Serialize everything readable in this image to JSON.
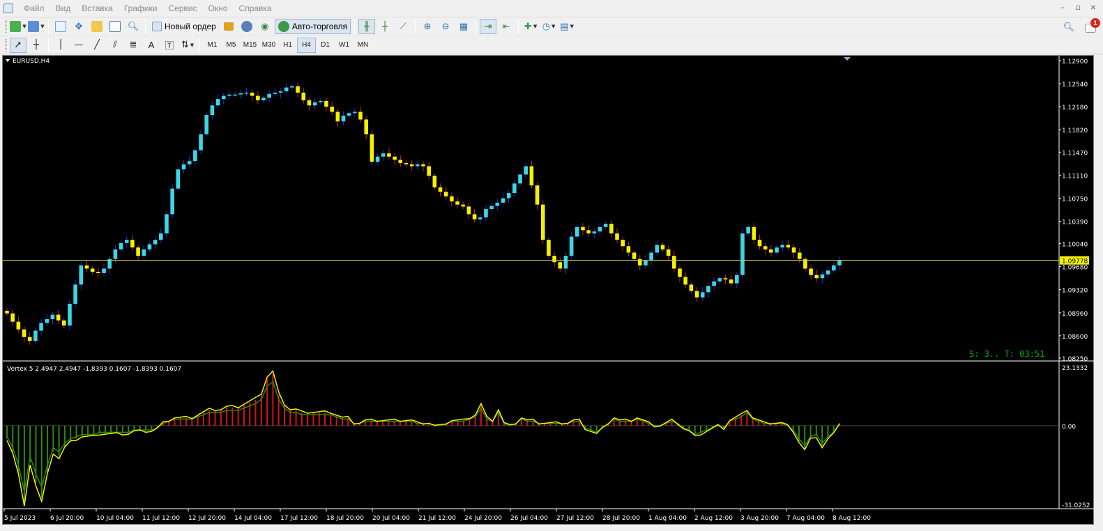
{
  "menu": [
    "Файл",
    "Вид",
    "Вставка",
    "Графики",
    "Сервис",
    "Окно",
    "Справка"
  ],
  "window_controls": [
    "–",
    "▫",
    "×"
  ],
  "toolbar": {
    "new_order_label": "Новый ордер",
    "autotrade_label": "Авто-торговля",
    "notification_count": "1"
  },
  "timeframes": [
    "M1",
    "M5",
    "M15",
    "M30",
    "H1",
    "H4",
    "D1",
    "W1",
    "MN"
  ],
  "active_timeframe": "H4",
  "chart": {
    "symbol_label": "EURUSD,H4",
    "indicator_label": "Vertex 5 2.4947 2.4947 -1.8393 0.1607 -1.8393 0.1607",
    "current_price_label": "1.09778",
    "status_text": "S: 3.. T: 03:51",
    "price_ticks": [
      "1.12900",
      "1.12540",
      "1.12180",
      "1.11820",
      "1.11470",
      "1.11110",
      "1.10750",
      "1.10390",
      "1.10040",
      "1.09680",
      "1.09320",
      "1.08960",
      "1.08600",
      "1.08250"
    ],
    "indicator_ticks": [
      "23.1332",
      "0.00",
      "-31.0252"
    ],
    "time_ticks": [
      "5 Jul 2023",
      "6 Jul 20:00",
      "10 Jul 04:00",
      "11 Jul 12:00",
      "12 Jul 20:00",
      "14 Jul 04:00",
      "17 Jul 12:00",
      "18 Jul 20:00",
      "20 Jul 04:00",
      "21 Jul 12:00",
      "24 Jul 20:00",
      "26 Jul 04:00",
      "27 Jul 12:00",
      "28 Jul 20:00",
      "1 Aug 04:00",
      "2 Aug 12:00",
      "3 Aug 20:00",
      "7 Aug 04:00",
      "8 Aug 12:00"
    ],
    "colors": {
      "background": "#000000",
      "bull": "#3cd6e6",
      "bear": "#f5f000",
      "wick": "#2030d0",
      "wick_bear": "#c03020",
      "price_line": "#c8c850",
      "axis_text": "#ffffff",
      "status_text": "#00b000",
      "osc_red": "#e01010",
      "osc_green": "#2a8a10",
      "osc_yellow": "#f5f000"
    }
  },
  "chart_data": {
    "type": "candlestick",
    "ylim": [
      1.0825,
      1.129
    ],
    "current_price": 1.09778,
    "closes": [
      1.0895,
      1.0882,
      1.087,
      1.0858,
      1.0852,
      1.0868,
      1.088,
      1.0886,
      1.0893,
      1.0884,
      1.0876,
      1.091,
      1.094,
      1.097,
      1.0965,
      1.096,
      1.0958,
      1.0965,
      1.098,
      1.0995,
      1.1005,
      1.101,
      1.0998,
      1.0985,
      1.0995,
      1.1003,
      1.101,
      1.102,
      1.105,
      1.109,
      1.112,
      1.1128,
      1.1133,
      1.115,
      1.1175,
      1.1205,
      1.122,
      1.123,
      1.1235,
      1.1237,
      1.1237,
      1.1239,
      1.124,
      1.1235,
      1.1228,
      1.1232,
      1.1238,
      1.124,
      1.1242,
      1.1248,
      1.125,
      1.124,
      1.1228,
      1.122,
      1.1225,
      1.1227,
      1.1218,
      1.121,
      1.1195,
      1.1204,
      1.1208,
      1.121,
      1.1198,
      1.1175,
      1.1132,
      1.114,
      1.1145,
      1.114,
      1.1135,
      1.113,
      1.1128,
      1.1125,
      1.1128,
      1.1125,
      1.111,
      1.1092,
      1.1085,
      1.1078,
      1.107,
      1.1065,
      1.1062,
      1.105,
      1.1042,
      1.1045,
      1.1058,
      1.1063,
      1.1068,
      1.1075,
      1.1083,
      1.1098,
      1.1112,
      1.1125,
      1.1095,
      1.1065,
      1.101,
      1.0985,
      1.0975,
      1.0965,
      1.0985,
      1.1015,
      1.103,
      1.1025,
      1.102,
      1.1023,
      1.103,
      1.1035,
      1.102,
      1.101,
      1.1,
      1.099,
      1.098,
      1.097,
      1.0978,
      1.099,
      1.1002,
      1.0995,
      1.0985,
      1.0965,
      1.0952,
      1.094,
      1.093,
      1.092,
      1.0928,
      1.0938,
      1.0945,
      1.095,
      1.0948,
      1.0942,
      1.0955,
      1.102,
      1.103,
      1.101,
      1.1,
      1.0995,
      1.099,
      1.0998,
      1.1002,
      1.0998,
      1.099,
      1.098,
      1.0965,
      1.0955,
      1.095,
      1.0956,
      1.0962,
      1.097,
      1.0978
    ],
    "oscillator_ylim": [
      -31.0252,
      23.1332
    ],
    "oscillator": [
      -5,
      -10,
      -18,
      -30,
      -14,
      -22,
      -28,
      -18,
      -10,
      -12,
      -8,
      -6,
      -5,
      -4,
      -4,
      -4,
      -3,
      -3,
      -3,
      -3,
      -3,
      -3,
      -2,
      -2,
      -2,
      -2,
      -1,
      1,
      2,
      3,
      3,
      3,
      3,
      4,
      5,
      6,
      6,
      6,
      7,
      7,
      7,
      8,
      9,
      10,
      12,
      18,
      20,
      12,
      8,
      6,
      6,
      5,
      5,
      5,
      5,
      5,
      5,
      4,
      3,
      3,
      1,
      1,
      2,
      2,
      2,
      2,
      2,
      2,
      2,
      2,
      2,
      1,
      1,
      1,
      0,
      0,
      1,
      2,
      2,
      2,
      3,
      4,
      8,
      3,
      2,
      6,
      1,
      0,
      1,
      3,
      2,
      2,
      1,
      1,
      1,
      1,
      1,
      1,
      2,
      2,
      -1,
      -2,
      -3,
      -1,
      1,
      3,
      2,
      2,
      2,
      3,
      2,
      1,
      0,
      0,
      1,
      2,
      1,
      -1,
      -2,
      -4,
      -3,
      -2,
      -1,
      0,
      -1,
      2,
      3,
      4,
      6,
      3,
      2,
      1,
      1,
      1,
      1,
      0,
      -2,
      -6,
      -9,
      -5,
      -4,
      -8,
      -5,
      -3,
      1
    ]
  }
}
